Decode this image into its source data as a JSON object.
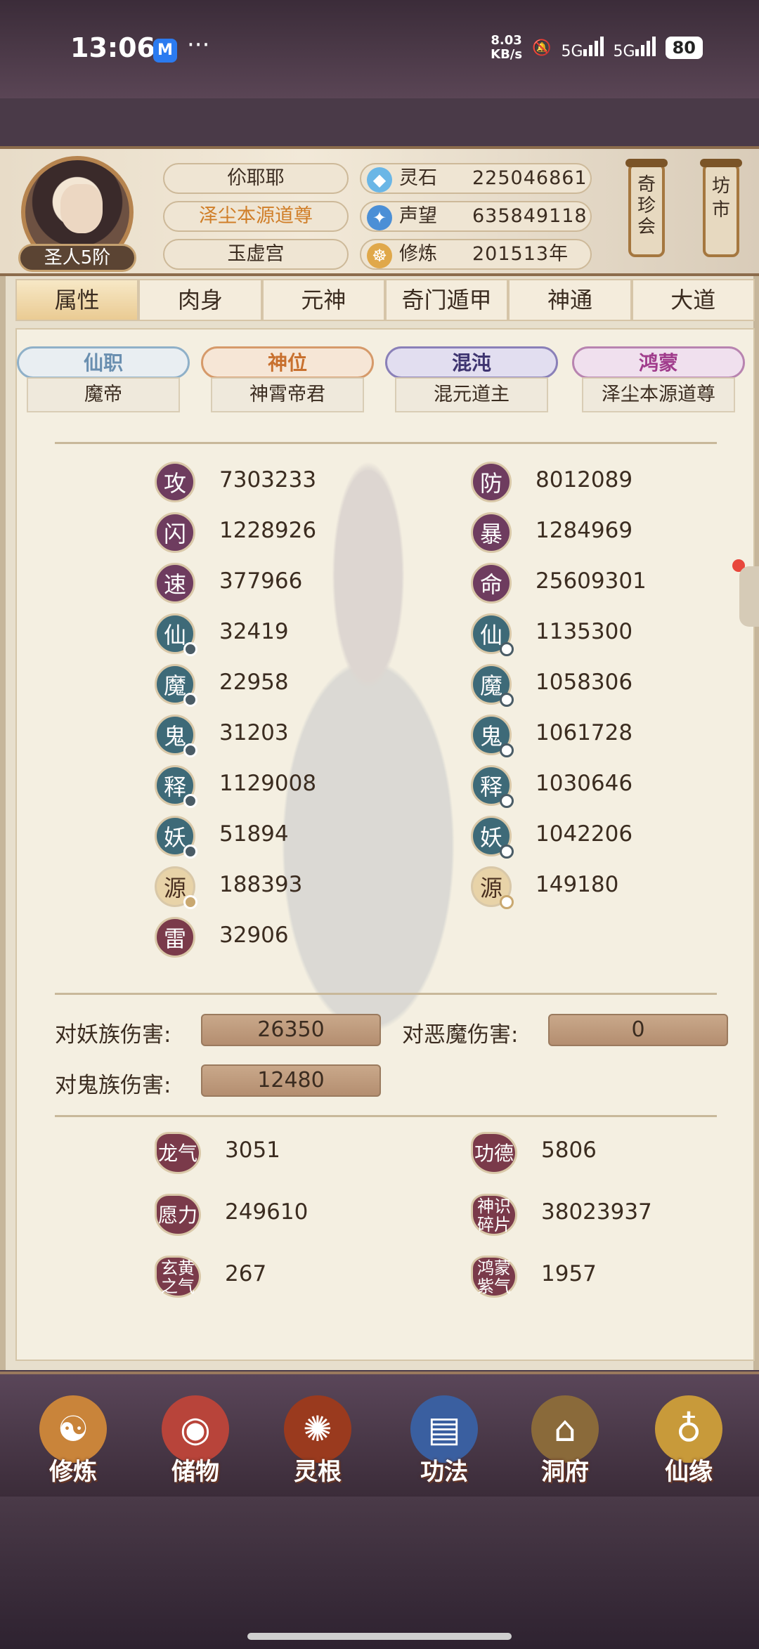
{
  "status_bar": {
    "time": "13:06",
    "app_badge": "M",
    "more": "···",
    "net_speed_value": "8.03",
    "net_speed_unit": "KB/s",
    "signal1": "5G",
    "signal2": "5G",
    "battery": "80"
  },
  "player": {
    "rank": "圣人5阶",
    "name": "伱耶耶",
    "title": "泽尘本源道尊",
    "sect": "玉虚宫"
  },
  "resources": [
    {
      "icon": "spirit-stone-icon",
      "label": "灵石",
      "value": "225046861"
    },
    {
      "icon": "reputation-icon",
      "label": "声望",
      "value": "635849118"
    },
    {
      "icon": "cultivation-icon",
      "label": "修炼",
      "value": "201513年"
    }
  ],
  "side_buttons": {
    "treasure": "奇珍会",
    "market": "坊市"
  },
  "tabs": [
    "属性",
    "肉身",
    "元神",
    "奇门遁甲",
    "神通",
    "大道"
  ],
  "titles": [
    {
      "label": "仙职",
      "value": "魔帝",
      "color": "#6a8fb0"
    },
    {
      "label": "神位",
      "value": "神霄帝君",
      "color": "#c8702e"
    },
    {
      "label": "混沌",
      "value": "混元道主",
      "color": "#3e3470"
    },
    {
      "label": "鸿蒙",
      "value": "泽尘本源道尊",
      "color": "#a03c8c"
    }
  ],
  "stats_left": [
    {
      "char": "攻",
      "value": "7303233"
    },
    {
      "char": "闪",
      "value": "1228926"
    },
    {
      "char": "速",
      "value": "377966"
    },
    {
      "char": "仙",
      "value": "32419"
    },
    {
      "char": "魔",
      "value": "22958"
    },
    {
      "char": "鬼",
      "value": "31203"
    },
    {
      "char": "释",
      "value": "1129008"
    },
    {
      "char": "妖",
      "value": "51894"
    },
    {
      "char": "源",
      "value": "188393"
    },
    {
      "char": "雷",
      "value": "32906"
    }
  ],
  "stats_right": [
    {
      "char": "防",
      "value": "8012089"
    },
    {
      "char": "暴",
      "value": "1284969"
    },
    {
      "char": "命",
      "value": "25609301"
    },
    {
      "char": "仙",
      "value": "1135300"
    },
    {
      "char": "魔",
      "value": "1058306"
    },
    {
      "char": "鬼",
      "value": "1061728"
    },
    {
      "char": "释",
      "value": "1030646"
    },
    {
      "char": "妖",
      "value": "1042206"
    },
    {
      "char": "源",
      "value": "149180"
    }
  ],
  "damage": {
    "vs_demon_race_label": "对妖族伤害:",
    "vs_demon_race": "26350",
    "vs_evil_label": "对恶魔伤害:",
    "vs_evil": "0",
    "vs_ghost_label": "对鬼族伤害:",
    "vs_ghost": "12480"
  },
  "extra": [
    {
      "label": "龙气",
      "value": "3051"
    },
    {
      "label": "功德",
      "value": "5806"
    },
    {
      "label": "愿力",
      "value": "249610"
    },
    {
      "label_1": "神识",
      "label_2": "碎片",
      "value": "38023937"
    },
    {
      "label_1": "玄黄",
      "label_2": "之气",
      "value": "267"
    },
    {
      "label_1": "鸿蒙",
      "label_2": "紫气",
      "value": "1957"
    }
  ],
  "bottom_nav": [
    "修炼",
    "储物",
    "灵根",
    "功法",
    "洞府",
    "仙缘"
  ]
}
